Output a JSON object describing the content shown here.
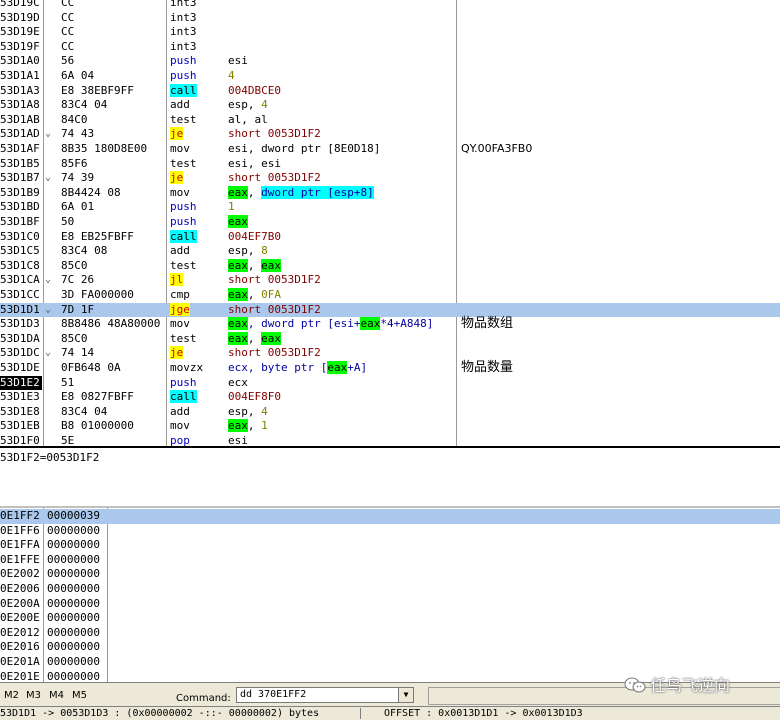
{
  "disassembly": {
    "rows": [
      {
        "addr": "53D19C",
        "br": "",
        "hex": "CC",
        "mn": "int3",
        "mk": "plain",
        "ops": []
      },
      {
        "addr": "53D19D",
        "br": "",
        "hex": "CC",
        "mn": "int3",
        "mk": "plain",
        "ops": []
      },
      {
        "addr": "53D19E",
        "br": "",
        "hex": "CC",
        "mn": "int3",
        "mk": "plain",
        "ops": []
      },
      {
        "addr": "53D19F",
        "br": "",
        "hex": "CC",
        "mn": "int3",
        "mk": "plain",
        "ops": []
      },
      {
        "addr": "53D1A0",
        "br": "",
        "hex": "56",
        "mn": "push",
        "mk": "push",
        "ops": [
          {
            "t": "esi",
            "s": "plain"
          }
        ]
      },
      {
        "addr": "53D1A1",
        "br": "",
        "hex": "6A 04",
        "mn": "push",
        "mk": "push",
        "ops": [
          {
            "t": "4",
            "s": "num"
          }
        ]
      },
      {
        "addr": "53D1A3",
        "br": "",
        "hex": "E8 38EBF9FF",
        "mn": "call",
        "mk": "call",
        "ops": [
          {
            "t": "004DBCE0",
            "s": "addr"
          }
        ]
      },
      {
        "addr": "53D1A8",
        "br": "",
        "hex": "83C4 04",
        "mn": "add",
        "mk": "plain",
        "ops": [
          {
            "t": "esp, ",
            "s": "plain"
          },
          {
            "t": "4",
            "s": "num"
          }
        ]
      },
      {
        "addr": "53D1AB",
        "br": "",
        "hex": "84C0",
        "mn": "test",
        "mk": "plain",
        "ops": [
          {
            "t": "al, al",
            "s": "plain"
          }
        ]
      },
      {
        "addr": "53D1AD",
        "br": "⌄",
        "hex": "74 43",
        "mn": "je",
        "mk": "jcc",
        "ops": [
          {
            "t": "short 0053D1F2",
            "s": "addr"
          }
        ]
      },
      {
        "addr": "53D1AF",
        "br": "",
        "hex": "8B35 180D8E00",
        "mn": "mov",
        "mk": "plain",
        "ops": [
          {
            "t": "esi, dword ptr [8E0D18]",
            "s": "plain"
          }
        ],
        "cmt": "QY.00FA3FB0",
        "cmtMono": true
      },
      {
        "addr": "53D1B5",
        "br": "",
        "hex": "85F6",
        "mn": "test",
        "mk": "plain",
        "ops": [
          {
            "t": "esi, esi",
            "s": "plain"
          }
        ]
      },
      {
        "addr": "53D1B7",
        "br": "⌄",
        "hex": "74 39",
        "mn": "je",
        "mk": "jcc",
        "ops": [
          {
            "t": "short 0053D1F2",
            "s": "addr"
          }
        ]
      },
      {
        "addr": "53D1B9",
        "br": "",
        "hex": "8B4424 08",
        "mn": "mov",
        "mk": "plain",
        "ops": [
          {
            "t": "eax",
            "s": "reg"
          },
          {
            "t": ", ",
            "s": "plain"
          },
          {
            "t": "dword ptr [esp+8]",
            "s": "ptrhl"
          }
        ]
      },
      {
        "addr": "53D1BD",
        "br": "",
        "hex": "6A 01",
        "mn": "push",
        "mk": "push",
        "ops": [
          {
            "t": "1",
            "s": "num"
          }
        ]
      },
      {
        "addr": "53D1BF",
        "br": "",
        "hex": "50",
        "mn": "push",
        "mk": "push",
        "ops": [
          {
            "t": "eax",
            "s": "reg"
          }
        ]
      },
      {
        "addr": "53D1C0",
        "br": "",
        "hex": "E8 EB25FBFF",
        "mn": "call",
        "mk": "call",
        "ops": [
          {
            "t": "004EF7B0",
            "s": "addr"
          }
        ]
      },
      {
        "addr": "53D1C5",
        "br": "",
        "hex": "83C4 08",
        "mn": "add",
        "mk": "plain",
        "ops": [
          {
            "t": "esp, ",
            "s": "plain"
          },
          {
            "t": "8",
            "s": "num"
          }
        ]
      },
      {
        "addr": "53D1C8",
        "br": "",
        "hex": "85C0",
        "mn": "test",
        "mk": "plain",
        "ops": [
          {
            "t": "eax",
            "s": "reg"
          },
          {
            "t": ", ",
            "s": "plain"
          },
          {
            "t": "eax",
            "s": "reg"
          }
        ]
      },
      {
        "addr": "53D1CA",
        "br": "⌄",
        "hex": "7C 26",
        "mn": "jl",
        "mk": "jcc",
        "ops": [
          {
            "t": "short 0053D1F2",
            "s": "addr"
          }
        ]
      },
      {
        "addr": "53D1CC",
        "br": "",
        "hex": "3D FA000000",
        "mn": "cmp",
        "mk": "plain",
        "ops": [
          {
            "t": "eax",
            "s": "reg"
          },
          {
            "t": ", ",
            "s": "plain"
          },
          {
            "t": "0FA",
            "s": "num"
          }
        ]
      },
      {
        "addr": "53D1D1",
        "br": "⌄",
        "hex": "7D 1F",
        "mn": "jge",
        "mk": "jcc",
        "ops": [
          {
            "t": "short 0053D1F2",
            "s": "addr"
          }
        ],
        "sel": true
      },
      {
        "addr": "53D1D3",
        "br": "",
        "hex": "8B8486 48A80000",
        "mn": "mov",
        "mk": "plain",
        "ops": [
          {
            "t": "eax",
            "s": "reg"
          },
          {
            "t": ", dword ptr [esi+",
            "s": "ptr"
          },
          {
            "t": "eax",
            "s": "reg"
          },
          {
            "t": "*4+A848]",
            "s": "ptr"
          }
        ],
        "cmt": "物品数组"
      },
      {
        "addr": "53D1DA",
        "br": "",
        "hex": "85C0",
        "mn": "test",
        "mk": "plain",
        "ops": [
          {
            "t": "eax",
            "s": "reg"
          },
          {
            "t": ", ",
            "s": "plain"
          },
          {
            "t": "eax",
            "s": "reg"
          }
        ]
      },
      {
        "addr": "53D1DC",
        "br": "⌄",
        "hex": "74 14",
        "mn": "je",
        "mk": "jcc",
        "ops": [
          {
            "t": "short 0053D1F2",
            "s": "addr"
          }
        ]
      },
      {
        "addr": "53D1DE",
        "br": "",
        "hex": "0FB648 0A",
        "mn": "movzx",
        "mk": "plain",
        "ops": [
          {
            "t": "ecx, byte ptr [",
            "s": "ptr"
          },
          {
            "t": "eax",
            "s": "reg"
          },
          {
            "t": "+A]",
            "s": "ptr"
          }
        ],
        "cmt": "物品数量"
      },
      {
        "addr": "53D1E2",
        "br": "",
        "hex": "51",
        "mn": "push",
        "mk": "push",
        "ops": [
          {
            "t": "ecx",
            "s": "plain"
          }
        ],
        "addrHl": true
      },
      {
        "addr": "53D1E3",
        "br": "",
        "hex": "E8 0827FBFF",
        "mn": "call",
        "mk": "call",
        "ops": [
          {
            "t": "004EF8F0",
            "s": "addr"
          }
        ]
      },
      {
        "addr": "53D1E8",
        "br": "",
        "hex": "83C4 04",
        "mn": "add",
        "mk": "plain",
        "ops": [
          {
            "t": "esp, ",
            "s": "plain"
          },
          {
            "t": "4",
            "s": "num"
          }
        ]
      },
      {
        "addr": "53D1EB",
        "br": "",
        "hex": "B8 01000000",
        "mn": "mov",
        "mk": "plain",
        "ops": [
          {
            "t": "eax",
            "s": "reg"
          },
          {
            "t": ", ",
            "s": "plain"
          },
          {
            "t": "1",
            "s": "num"
          }
        ]
      },
      {
        "addr": "53D1F0",
        "br": "",
        "hex": "5E",
        "mn": "pop",
        "mk": "push",
        "ops": [
          {
            "t": "esi",
            "s": "plain"
          }
        ]
      }
    ]
  },
  "info": {
    "text": "53D1F2=0053D1F2"
  },
  "dump": {
    "rows": [
      {
        "addr": "0E1FF2",
        "val": "00000039",
        "sel": true
      },
      {
        "addr": "0E1FF6",
        "val": "00000000"
      },
      {
        "addr": "0E1FFA",
        "val": "00000000"
      },
      {
        "addr": "0E1FFE",
        "val": "00000000"
      },
      {
        "addr": "0E2002",
        "val": "00000000"
      },
      {
        "addr": "0E2006",
        "val": "00000000"
      },
      {
        "addr": "0E200A",
        "val": "00000000"
      },
      {
        "addr": "0E200E",
        "val": "00000000"
      },
      {
        "addr": "0E2012",
        "val": "00000000"
      },
      {
        "addr": "0E2016",
        "val": "00000000"
      },
      {
        "addr": "0E201A",
        "val": "00000000"
      },
      {
        "addr": "0E201E",
        "val": "00000000"
      }
    ]
  },
  "command_bar": {
    "tabs": [
      "M2",
      "M3",
      "M4",
      "M5"
    ],
    "label": "Command:",
    "input_value": "dd 370E1FF2"
  },
  "status": {
    "left": "53D1D1 -> 0053D1D3 : (0x00000002  -::-  00000002) bytes",
    "right": "OFFSET : 0x0013D1D1 -> 0x0013D1D3"
  },
  "watermark": {
    "text": "任鸟飞逆向"
  },
  "colors": {
    "selection": "#aac8ec",
    "call_bg": "#00ffff",
    "jump_bg": "#ffff00",
    "jump_fg": "#d00000",
    "register_hl": "#00ff00",
    "push_fg": "#0000c8",
    "address_fg": "#800000",
    "number_fg": "#808000"
  }
}
